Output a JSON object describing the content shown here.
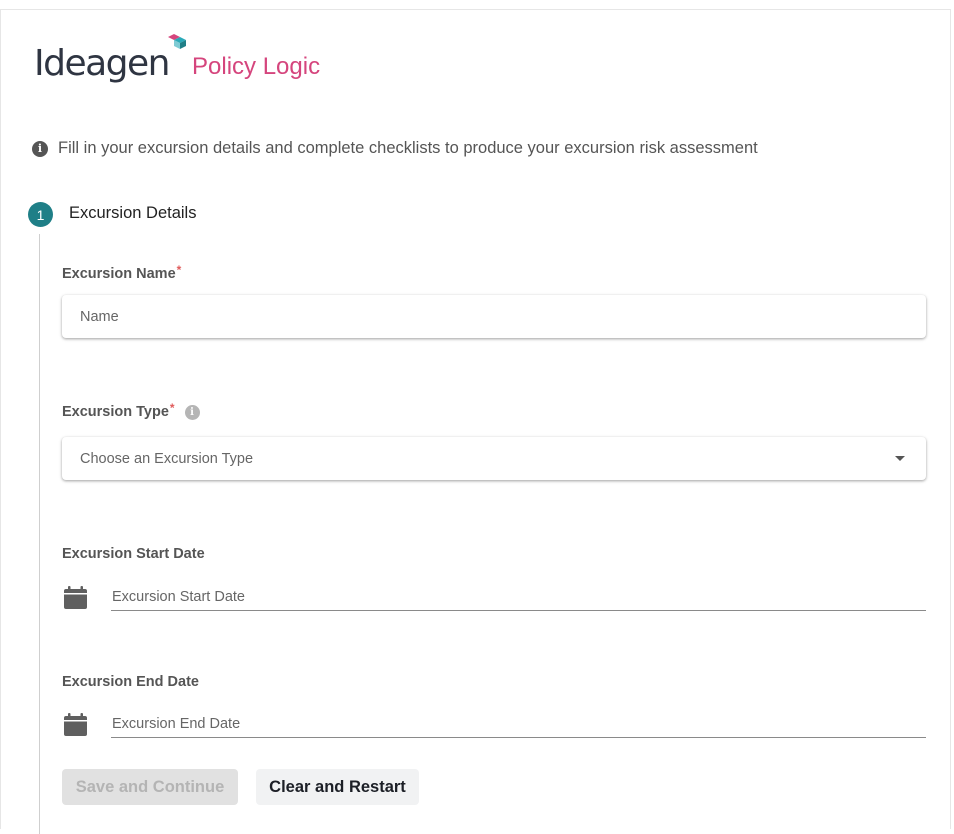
{
  "brand": {
    "company": "Ideagen",
    "product": "Policy Logic",
    "product_color": "#d5457d",
    "mark_colors": [
      "#d5457d",
      "#2aa9b8",
      "#1f7f87"
    ]
  },
  "intro": {
    "icon": "info-circle-icon",
    "text": "Fill in your excursion details and complete checklists to produce your excursion risk assessment"
  },
  "stepper": {
    "steps": [
      {
        "number": "1",
        "title": "Excursion Details",
        "active_color": "#1f7f87"
      }
    ]
  },
  "form": {
    "name": {
      "label": "Excursion Name",
      "required_mark": "*",
      "placeholder": "Name",
      "value": ""
    },
    "type": {
      "label": "Excursion Type",
      "required_mark": "*",
      "info_icon": "info-circle-icon",
      "placeholder": "Choose an Excursion Type",
      "dropdown_icon": "caret-down-icon"
    },
    "start_date": {
      "label": "Excursion Start Date",
      "icon": "calendar-icon",
      "placeholder": "Excursion Start Date",
      "value": ""
    },
    "end_date": {
      "label": "Excursion End Date",
      "icon": "calendar-icon",
      "placeholder": "Excursion End Date",
      "value": ""
    }
  },
  "actions": {
    "save_label": "Save and Continue",
    "save_disabled": true,
    "clear_label": "Clear and Restart"
  }
}
